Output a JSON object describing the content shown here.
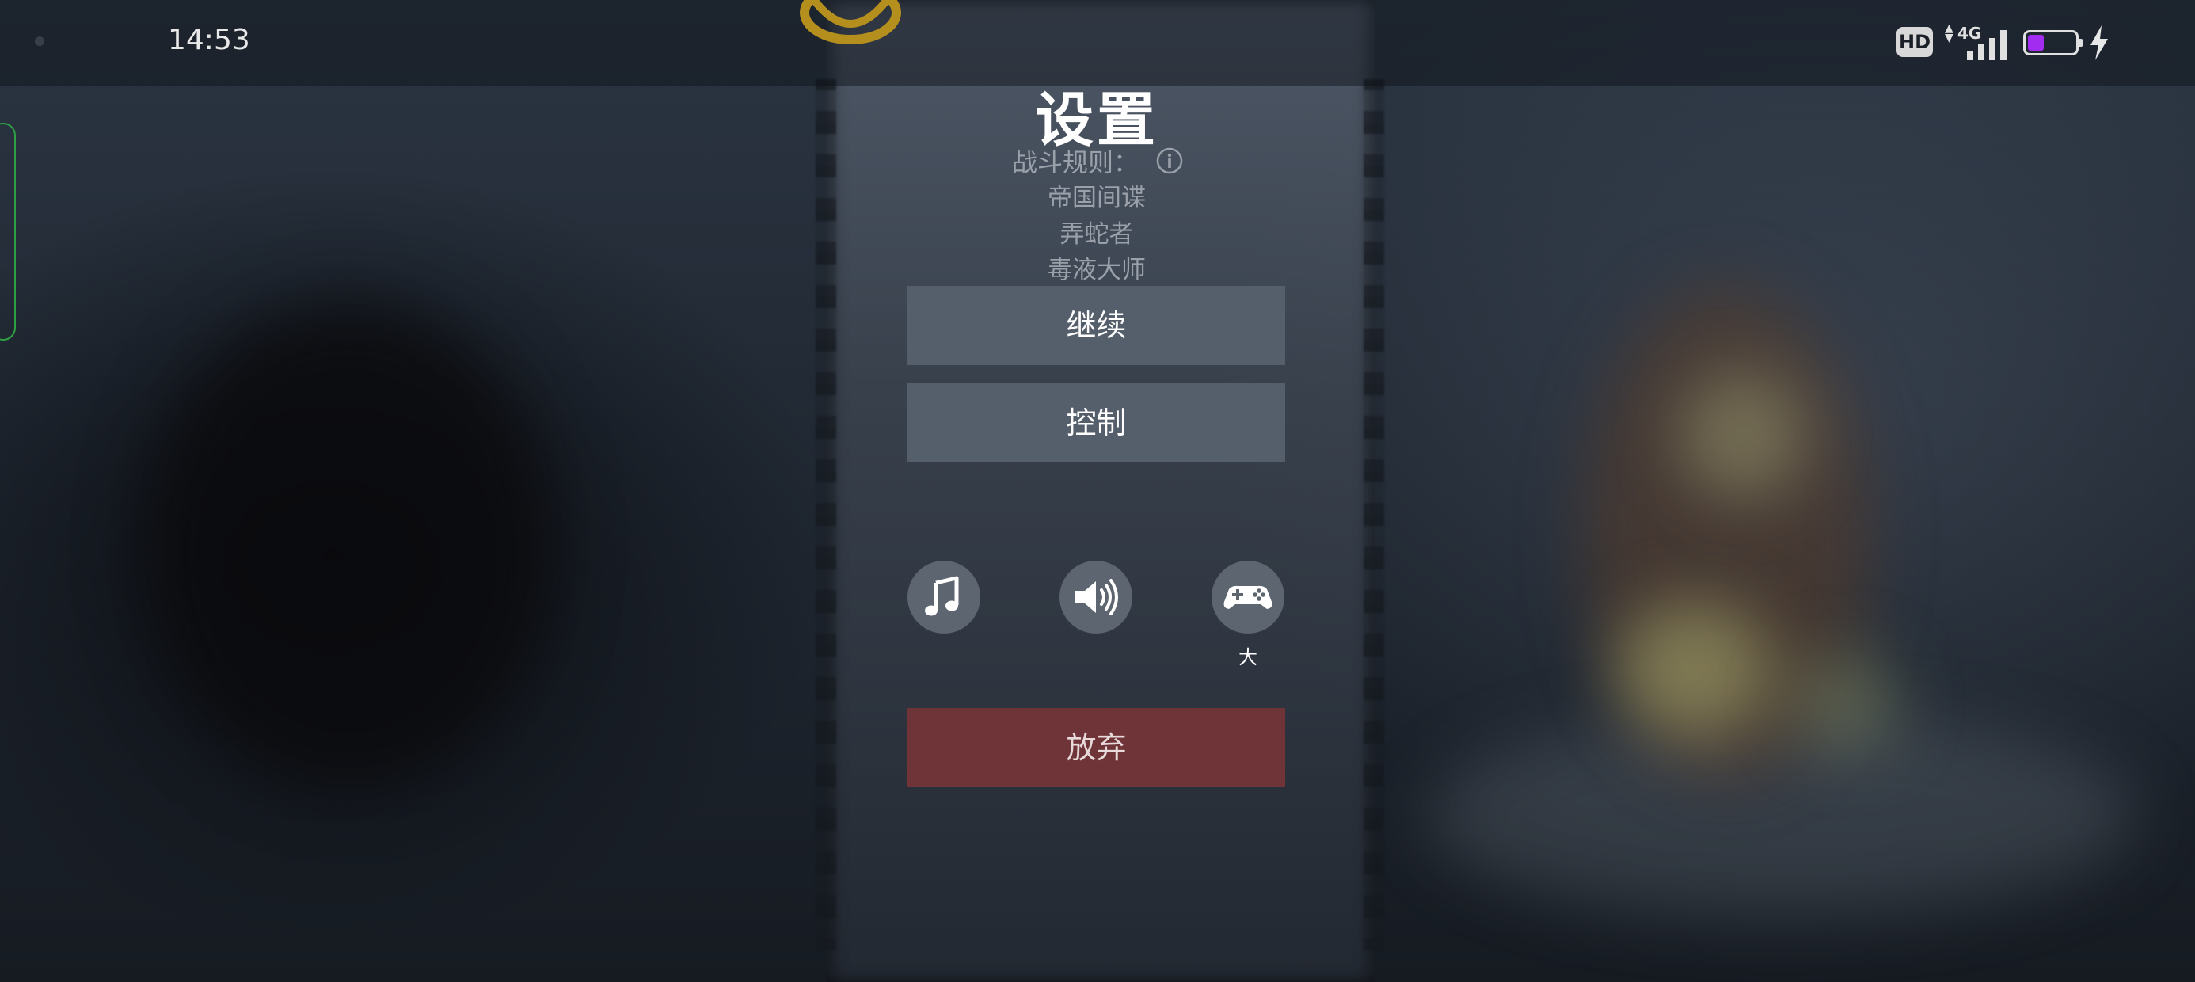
{
  "status_bar": {
    "time": "14:53",
    "hd_badge": "HD",
    "network": "4G",
    "battery_color": "#a22cf0",
    "battery_fraction": 0.35,
    "charging": true
  },
  "menu": {
    "title": "设置",
    "rules_label": "战斗规则：",
    "rules": [
      "帝国间谍",
      "弄蛇者",
      "毒液大师"
    ],
    "continue_label": "继续",
    "controls_label": "控制",
    "quit_label": "放弃",
    "quit_color": "#6e3437"
  },
  "toggles": {
    "music_icon": "music-note-icon",
    "sound_icon": "speaker-icon",
    "gamepad_icon": "gamepad-icon",
    "gamepad_size": "大"
  }
}
